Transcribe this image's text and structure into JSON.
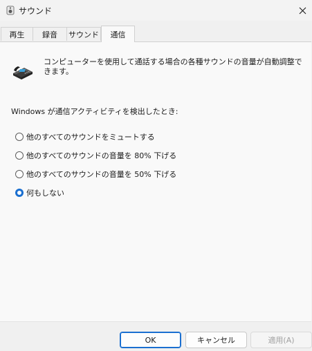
{
  "window": {
    "title": "サウンド",
    "icon": "speaker-icon",
    "close": "close-icon"
  },
  "tabs": [
    {
      "label": "再生",
      "active": false
    },
    {
      "label": "録音",
      "active": false
    },
    {
      "label": "サウンド",
      "active": false
    },
    {
      "label": "通信",
      "active": true
    }
  ],
  "communications": {
    "icon": "telephone-icon",
    "description": "コンピューターを使用して通話する場合の各種サウンドの音量が自動調整できます。",
    "detect_label": "Windows が通信アクティビティを検出したとき:",
    "options": [
      {
        "label": "他のすべてのサウンドをミュートする",
        "selected": false
      },
      {
        "label": "他のすべてのサウンドの音量を 80% 下げる",
        "selected": false
      },
      {
        "label": "他のすべてのサウンドの音量を 50% 下げる",
        "selected": false
      },
      {
        "label": "何もしない",
        "selected": true
      }
    ]
  },
  "buttons": {
    "ok": "OK",
    "cancel": "キャンセル",
    "apply": "適用(A)"
  },
  "colors": {
    "accent": "#1a6fd0",
    "panel": "#f9f9f9",
    "background": "#f0f0f0"
  }
}
